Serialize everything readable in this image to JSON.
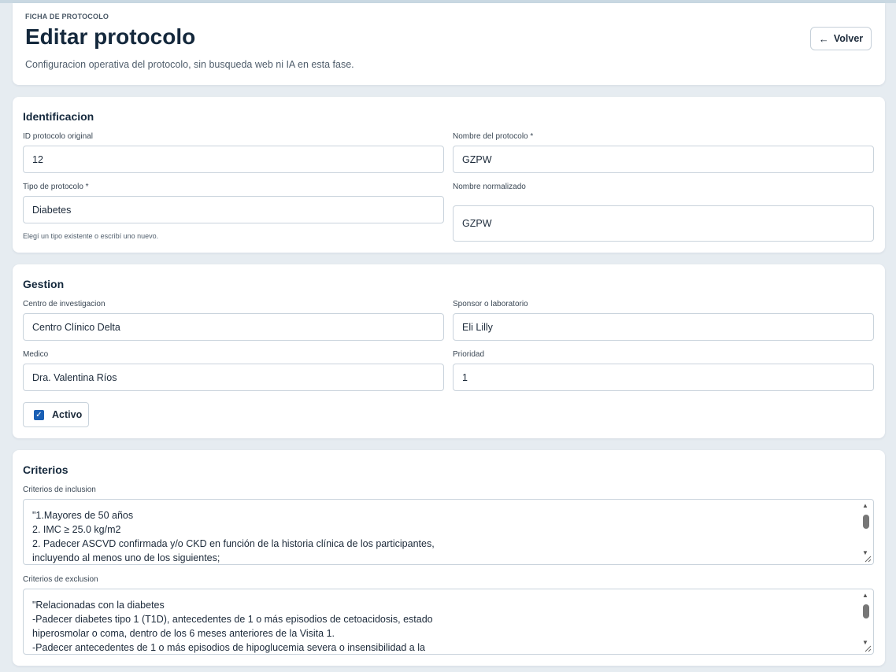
{
  "header": {
    "eyebrow": "FICHA DE PROTOCOLO",
    "title": "Editar protocolo",
    "subtitle": "Configuracion operativa del protocolo, sin busqueda web ni IA en esta fase.",
    "back_label": "Volver"
  },
  "identificacion": {
    "title": "Identificacion",
    "id_label": "ID protocolo original",
    "id_value": "12",
    "nombre_label": "Nombre del protocolo *",
    "nombre_value": "GZPW",
    "tipo_label": "Tipo de protocolo *",
    "tipo_value": "Diabetes",
    "tipo_help": "Elegí un tipo existente o escribí uno nuevo.",
    "normalizado_label": "Nombre normalizado",
    "normalizado_value": "GZPW"
  },
  "gestion": {
    "title": "Gestion",
    "centro_label": "Centro de investigacion",
    "centro_value": "Centro Clínico Delta",
    "sponsor_label": "Sponsor o laboratorio",
    "sponsor_value": "Eli Lilly",
    "medico_label": "Medico",
    "medico_value": "Dra. Valentina Ríos",
    "prioridad_label": "Prioridad",
    "prioridad_value": "1",
    "activo_label": "Activo",
    "activo_checked": true
  },
  "criterios": {
    "title": "Criterios",
    "inclusion_label": "Criterios de inclusion",
    "inclusion_value": "\"1.Mayores de 50 años\n2. IMC ≥ 25.0 kg/m2\n2. Padecer ASCVD confirmada y/o CKD en función de la historia clínica de los participantes,\nincluyendo al menos uno de los siguientes;",
    "exclusion_label": "Criterios de exclusion",
    "exclusion_value": "\"Relacionadas con la diabetes\n-Padecer diabetes tipo 1 (T1D), antecedentes de 1 o más episodios de cetoacidosis, estado\nhiperosmolar o coma, dentro de los 6 meses anteriores de la Visita 1.\n-Padecer antecedentes de 1 o más episodios de hipoglucemia severa o insensibilidad a la"
  }
}
